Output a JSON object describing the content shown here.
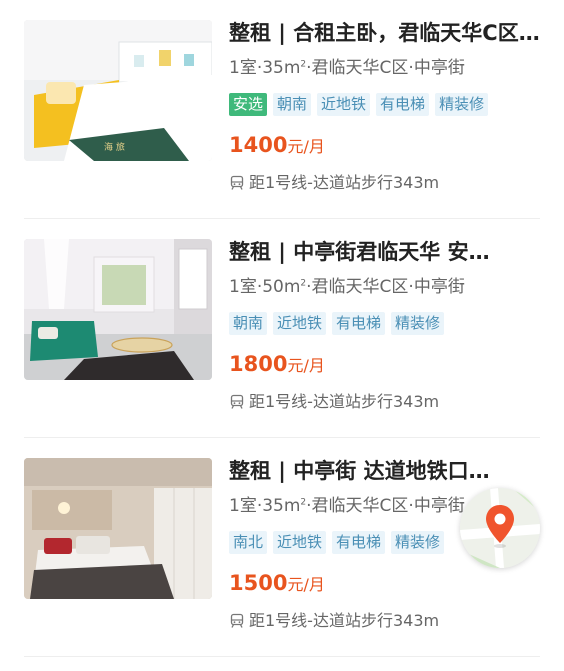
{
  "listings": [
    {
      "title": "整租 | 合租主卧，君临天华C区…",
      "layout": "1室·35m",
      "sup": "2",
      "location": "·君临天华C区·中亭街",
      "tags": [
        "安选",
        "朝南",
        "近地铁",
        "有电梯",
        "精装修"
      ],
      "featured_tag_index": 0,
      "price": "1400",
      "price_unit": "元/月",
      "subway": "距1号线-达道站步行343m"
    },
    {
      "title": "整租 | 中亭街君临天华 安…",
      "layout": "1室·50m",
      "sup": "2",
      "location": "·君临天华C区·中亭街",
      "tags": [
        "朝南",
        "近地铁",
        "有电梯",
        "精装修"
      ],
      "featured_tag_index": -1,
      "price": "1800",
      "price_unit": "元/月",
      "subway": "距1号线-达道站步行343m"
    },
    {
      "title": "整租 | 中亭街 达道地铁口…",
      "layout": "1室·35m",
      "sup": "2",
      "location": "·君临天华C区·中亭街",
      "tags": [
        "南北",
        "近地铁",
        "有电梯",
        "精装修"
      ],
      "featured_tag_index": -1,
      "price": "1500",
      "price_unit": "元/月",
      "subway": "距1号线-达道站步行343m"
    }
  ],
  "icons": {
    "subway": "train-icon",
    "map": "map-pin-icon"
  },
  "colors": {
    "price": "#e8541e",
    "featured_tag": "#3fb97b",
    "tag_text": "#4a8fb5",
    "tag_bg": "#eaf4fa",
    "map_pin": "#f0542d"
  }
}
